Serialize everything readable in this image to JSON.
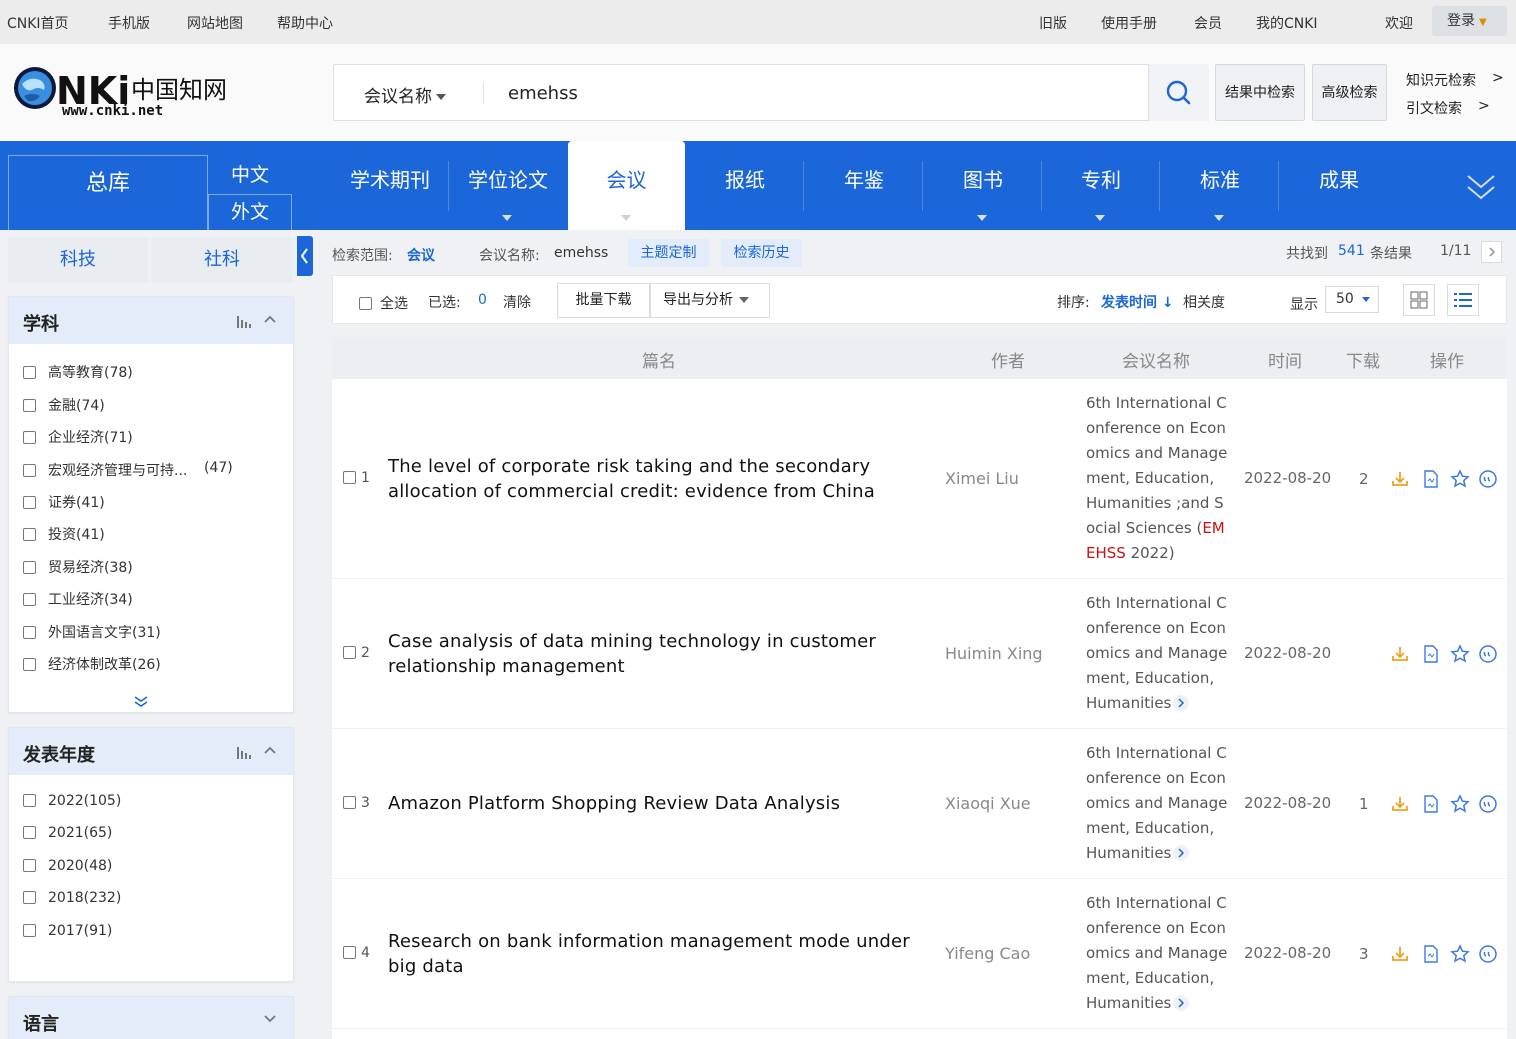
{
  "topbar": {
    "home": "CNKI首页",
    "mobile": "手机版",
    "sitemap": "网站地图",
    "help": "帮助中心",
    "old_version": "旧版",
    "manual": "使用手册",
    "member": "会员",
    "my_cnki": "我的CNKI",
    "welcome": "欢迎",
    "login": "登录"
  },
  "logo": {
    "main": "CNKi中国知网",
    "url": "www.cnki.net"
  },
  "search": {
    "scope": "会议名称",
    "query": "emehss",
    "search_in_results": "结果中检索",
    "advanced": "高级检索",
    "knowledge_search": "知识元检索",
    "citation_search": "引文检索",
    "arrow": ">"
  },
  "nav": {
    "zongku": "总库",
    "chinese": "中文",
    "foreign": "外文",
    "tabs": [
      "学术期刊",
      "学位论文",
      "会议",
      "报纸",
      "年鉴",
      "图书",
      "专利",
      "标准",
      "成果"
    ]
  },
  "sidebar": {
    "tabs": [
      "科技",
      "社科"
    ],
    "subject": {
      "title": "学科",
      "items": [
        "高等教育(78)",
        "金融(74)",
        "企业经济(71)",
        "宏观经济管理与可持...",
        "证券(41)",
        "投资(41)",
        "贸易经济(38)",
        "工业经济(34)",
        "外国语言文字(31)",
        "经济体制改革(26)"
      ],
      "item4_count": "(47)"
    },
    "year": {
      "title": "发表年度",
      "items": [
        "2022(105)",
        "2021(65)",
        "2020(48)",
        "2018(232)",
        "2017(91)"
      ]
    },
    "language": {
      "title": "语言"
    }
  },
  "scopebar": {
    "range_label": "检索范围:",
    "range_value": "会议",
    "cond_label": "会议名称:",
    "cond_value": "emehss",
    "topic_btn": "主题定制",
    "history_btn": "检索历史",
    "found_prefix": "共找到",
    "found_count": "541",
    "found_suffix": "条结果",
    "page": "1/11"
  },
  "toolbar": {
    "select_all": "全选",
    "selected_label": "已选:",
    "selected_count": "0",
    "clear": "清除",
    "batch_download": "批量下载",
    "export": "导出与分析",
    "sort_label": "排序:",
    "sort_time": "发表时间",
    "sort_relevance": "相关度",
    "display_label": "显示",
    "display_value": "50"
  },
  "table": {
    "headers": [
      "篇名",
      "作者",
      "会议名称",
      "时间",
      "下载",
      "操作"
    ],
    "rows": [
      {
        "no": "1",
        "title": "The level of corporate risk taking and the secondary allocation of commercial credit: evidence from China",
        "author": "Ximei Liu",
        "conf_main": "6th International Conference on Economics and Management, Education, Humanities ;and Social Sciences (",
        "conf_hl": "EMEHSS",
        "conf_tail": " 2022)",
        "date": "2022-08-20",
        "downloads": "2"
      },
      {
        "no": "2",
        "title": "Case analysis of data mining technology in customer relationship management",
        "author": "Huimin Xing",
        "conf_main": "6th International Conference on Economics and Management, Education, Humanities",
        "date": "2022-08-20",
        "downloads": ""
      },
      {
        "no": "3",
        "title": "Amazon Platform Shopping Review Data Analysis",
        "author": "Xiaoqi Xue",
        "conf_main": "6th International Conference on Economics and Management, Education, Humanities",
        "date": "2022-08-20",
        "downloads": "1"
      },
      {
        "no": "4",
        "title": "Research on bank information management mode under big data",
        "author": "Yifeng Cao",
        "conf_main": "6th International Conference on Economics and Management, Education, Humanities",
        "date": "2022-08-20",
        "downloads": "3"
      }
    ]
  },
  "colors": {
    "brand_blue": "#1b66d8",
    "highlight_red": "#cc1111",
    "download_orange": "#f0a020"
  }
}
